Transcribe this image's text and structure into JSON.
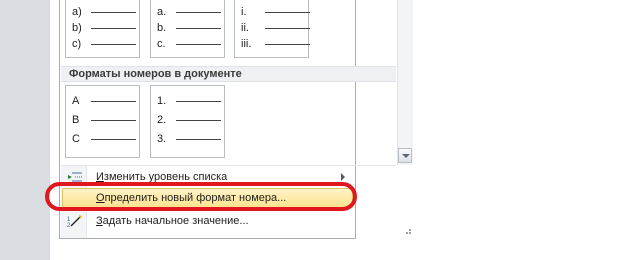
{
  "gallery": {
    "top_boxes": [
      {
        "rows": [
          {
            "marker": "a)"
          },
          {
            "marker": "b)"
          },
          {
            "marker": "c)"
          }
        ]
      },
      {
        "rows": [
          {
            "marker": "a."
          },
          {
            "marker": "b."
          },
          {
            "marker": "c."
          }
        ]
      },
      {
        "rows": [
          {
            "marker": "i."
          },
          {
            "marker": "ii."
          },
          {
            "marker": "iii."
          }
        ]
      }
    ],
    "section_title": "Форматы номеров в документе",
    "doc_boxes": [
      {
        "rows": [
          {
            "marker": "A"
          },
          {
            "marker": "B"
          },
          {
            "marker": "C"
          }
        ]
      },
      {
        "rows": [
          {
            "marker": "1."
          },
          {
            "marker": "2."
          },
          {
            "marker": "3."
          }
        ]
      }
    ]
  },
  "menu": {
    "items": [
      {
        "label_u": "И",
        "label_rest": "зменить уровень списка",
        "icon": "change-list-level-icon",
        "has_submenu": true
      },
      {
        "label_u": "О",
        "label_rest": "пределить новый формат номера...",
        "icon": "none",
        "highlighted": true
      },
      {
        "label_u": "З",
        "label_rest": "адать начальное значение...",
        "icon": "set-numbering-value-icon"
      }
    ]
  },
  "colors": {
    "highlight_start": "#fff3c6",
    "highlight_end": "#fde48f",
    "annotation_red": "#e0171f"
  }
}
